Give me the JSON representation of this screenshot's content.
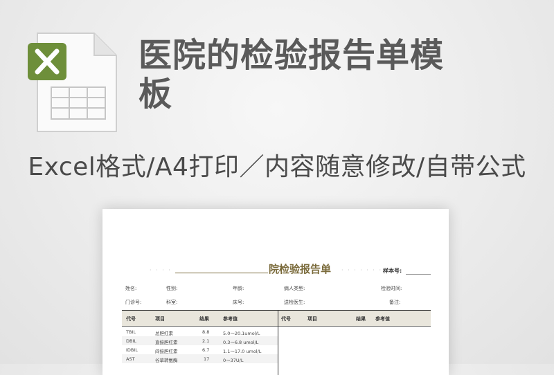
{
  "header": {
    "title": "医院的检验报告单模板",
    "subtitle": "Excel格式/A4打印／内容随意修改/自带公式",
    "icon": "excel-file-icon",
    "accent": "#6e8f3a"
  },
  "report": {
    "title": "院检验报告单",
    "sample_label": "样本号:",
    "fields_row1": [
      "姓名:",
      "性别:",
      "年龄:",
      "病人类型:",
      "检验时间:"
    ],
    "fields_row2": [
      "门诊号:",
      "科室:",
      "床号:",
      "送检医生:",
      "备注:"
    ],
    "columns": [
      "代号",
      "项目",
      "结果",
      "参考值"
    ],
    "columns_right": [
      "代号",
      "项目",
      "结果",
      "参考值"
    ],
    "rows": [
      {
        "code": "TBIL",
        "item": "总胆红素",
        "result": "8.8",
        "ref": "5.0～20.1umol/L"
      },
      {
        "code": "DBIL",
        "item": "直接胆红素",
        "result": "2.1",
        "ref": "0.3～6.8  umol/L"
      },
      {
        "code": "IDBIL",
        "item": "间接胆红素",
        "result": "6.7",
        "ref": "1.1～17.0 umol/L"
      },
      {
        "code": "AST",
        "item": "谷草转氨酶",
        "result": "17",
        "ref": "0～37U/L"
      }
    ]
  }
}
